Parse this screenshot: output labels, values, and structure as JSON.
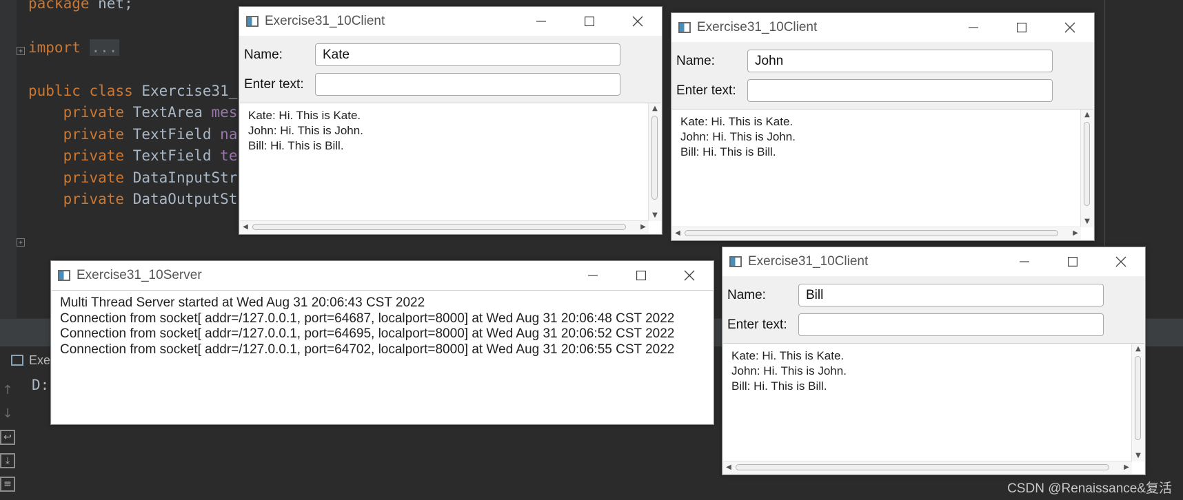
{
  "ide": {
    "code": {
      "line_package_kw": "package",
      "line_package_name": " net;",
      "line_import_kw": "import",
      "line_import_dots": "...",
      "line_class_public": "public",
      "line_class_class": "class",
      "line_class_name": " Exercise31_",
      "fields": [
        {
          "kw": "private",
          "type": " TextArea ",
          "name": "mes"
        },
        {
          "kw": "private",
          "type": " TextField ",
          "name": "na"
        },
        {
          "kw": "private",
          "type": " TextField ",
          "name": "te"
        },
        {
          "kw": "private",
          "type": " DataInputStr",
          "name": ""
        },
        {
          "kw": "private",
          "type": " DataOutputSt",
          "name": ""
        }
      ]
    },
    "run_tab_label": "Exe",
    "console_text": "D:",
    "fold_plus": "+"
  },
  "watermark": "CSDN @Renaissance&复活",
  "icons": {
    "minimize": "minimize-icon",
    "maximize": "maximize-icon",
    "close": "close-icon",
    "up": "▲",
    "down": "▼",
    "left": "◀",
    "right": "▶"
  },
  "labels": {
    "name": "Name:",
    "enter_text": "Enter text:"
  },
  "server": {
    "title": "Exercise31_10Server",
    "log": [
      "Multi Thread Server started at Wed Aug 31 20:06:43 CST 2022",
      "Connection from socket[ addr=/127.0.0.1, port=64687, localport=8000] at Wed Aug 31 20:06:48 CST 2022",
      "Connection from socket[ addr=/127.0.0.1, port=64695, localport=8000] at Wed Aug 31 20:06:52 CST 2022",
      "Connection from socket[ addr=/127.0.0.1, port=64702, localport=8000] at Wed Aug 31 20:06:55 CST 2022"
    ]
  },
  "clients": [
    {
      "title": "Exercise31_10Client",
      "name_value": "Kate",
      "text_value": "",
      "messages": [
        "Kate: Hi. This is Kate.",
        "John: Hi. This is John.",
        "Bill: Hi. This is Bill."
      ]
    },
    {
      "title": "Exercise31_10Client",
      "name_value": "John",
      "text_value": "",
      "messages": [
        "Kate: Hi. This is Kate.",
        "John: Hi. This is John.",
        "Bill: Hi. This is Bill."
      ]
    },
    {
      "title": "Exercise31_10Client",
      "name_value": "Bill",
      "text_value": "",
      "messages": [
        "Kate: Hi. This is Kate.",
        "John: Hi. This is John.",
        "Bill: Hi. This is Bill."
      ]
    }
  ]
}
